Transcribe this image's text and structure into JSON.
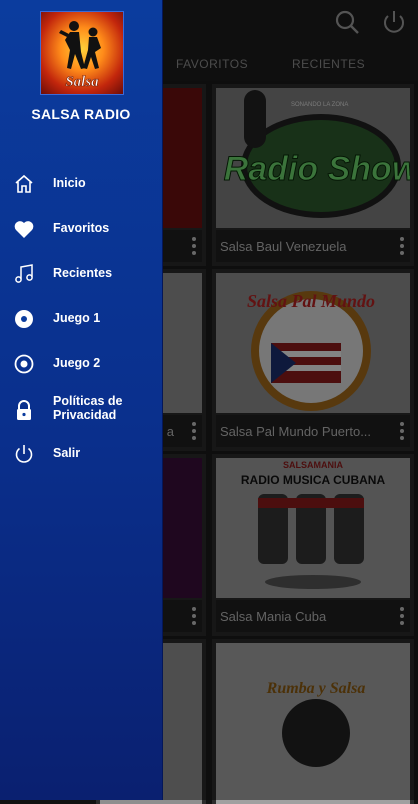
{
  "app": {
    "name": "SALSA RADIO",
    "logo_text": "Salsa"
  },
  "tabs": [
    {
      "label": "FAVORITOS"
    },
    {
      "label": "RECIENTES"
    }
  ],
  "menu": [
    {
      "label": "Inicio",
      "icon": "home-icon"
    },
    {
      "label": "Favoritos",
      "icon": "heart-icon"
    },
    {
      "label": "Recientes",
      "icon": "music-note-icon"
    },
    {
      "label": "Juego 1",
      "icon": "disc-icon"
    },
    {
      "label": "Juego 2",
      "icon": "radio-button-icon"
    },
    {
      "label": "Políticas de Privacidad",
      "icon": "lock-icon"
    },
    {
      "label": "Salir",
      "icon": "power-icon"
    }
  ],
  "cards": [
    {
      "title": "Salsa Baul Venezuela",
      "art_text": "Radio Show",
      "art_subtext": "SONANDO LA ZONA"
    },
    {
      "title": "Salsa Pal Mundo Puerto...",
      "art_text": "Salsa Pal Mundo"
    },
    {
      "title": "Salsa Mania Cuba",
      "art_text": "SALSAMANIA",
      "art_subtext": "RADIO MUSICA CUBANA"
    },
    {
      "title": "",
      "art_text": "Rumba y Salsa"
    }
  ],
  "left_cards": [
    {
      "title": ""
    },
    {
      "title": "a"
    },
    {
      "title": ""
    },
    {
      "title": ""
    }
  ],
  "colors": {
    "drawer": "#0a2f8c",
    "overlay": "rgba(0,0,0,0.45)"
  }
}
